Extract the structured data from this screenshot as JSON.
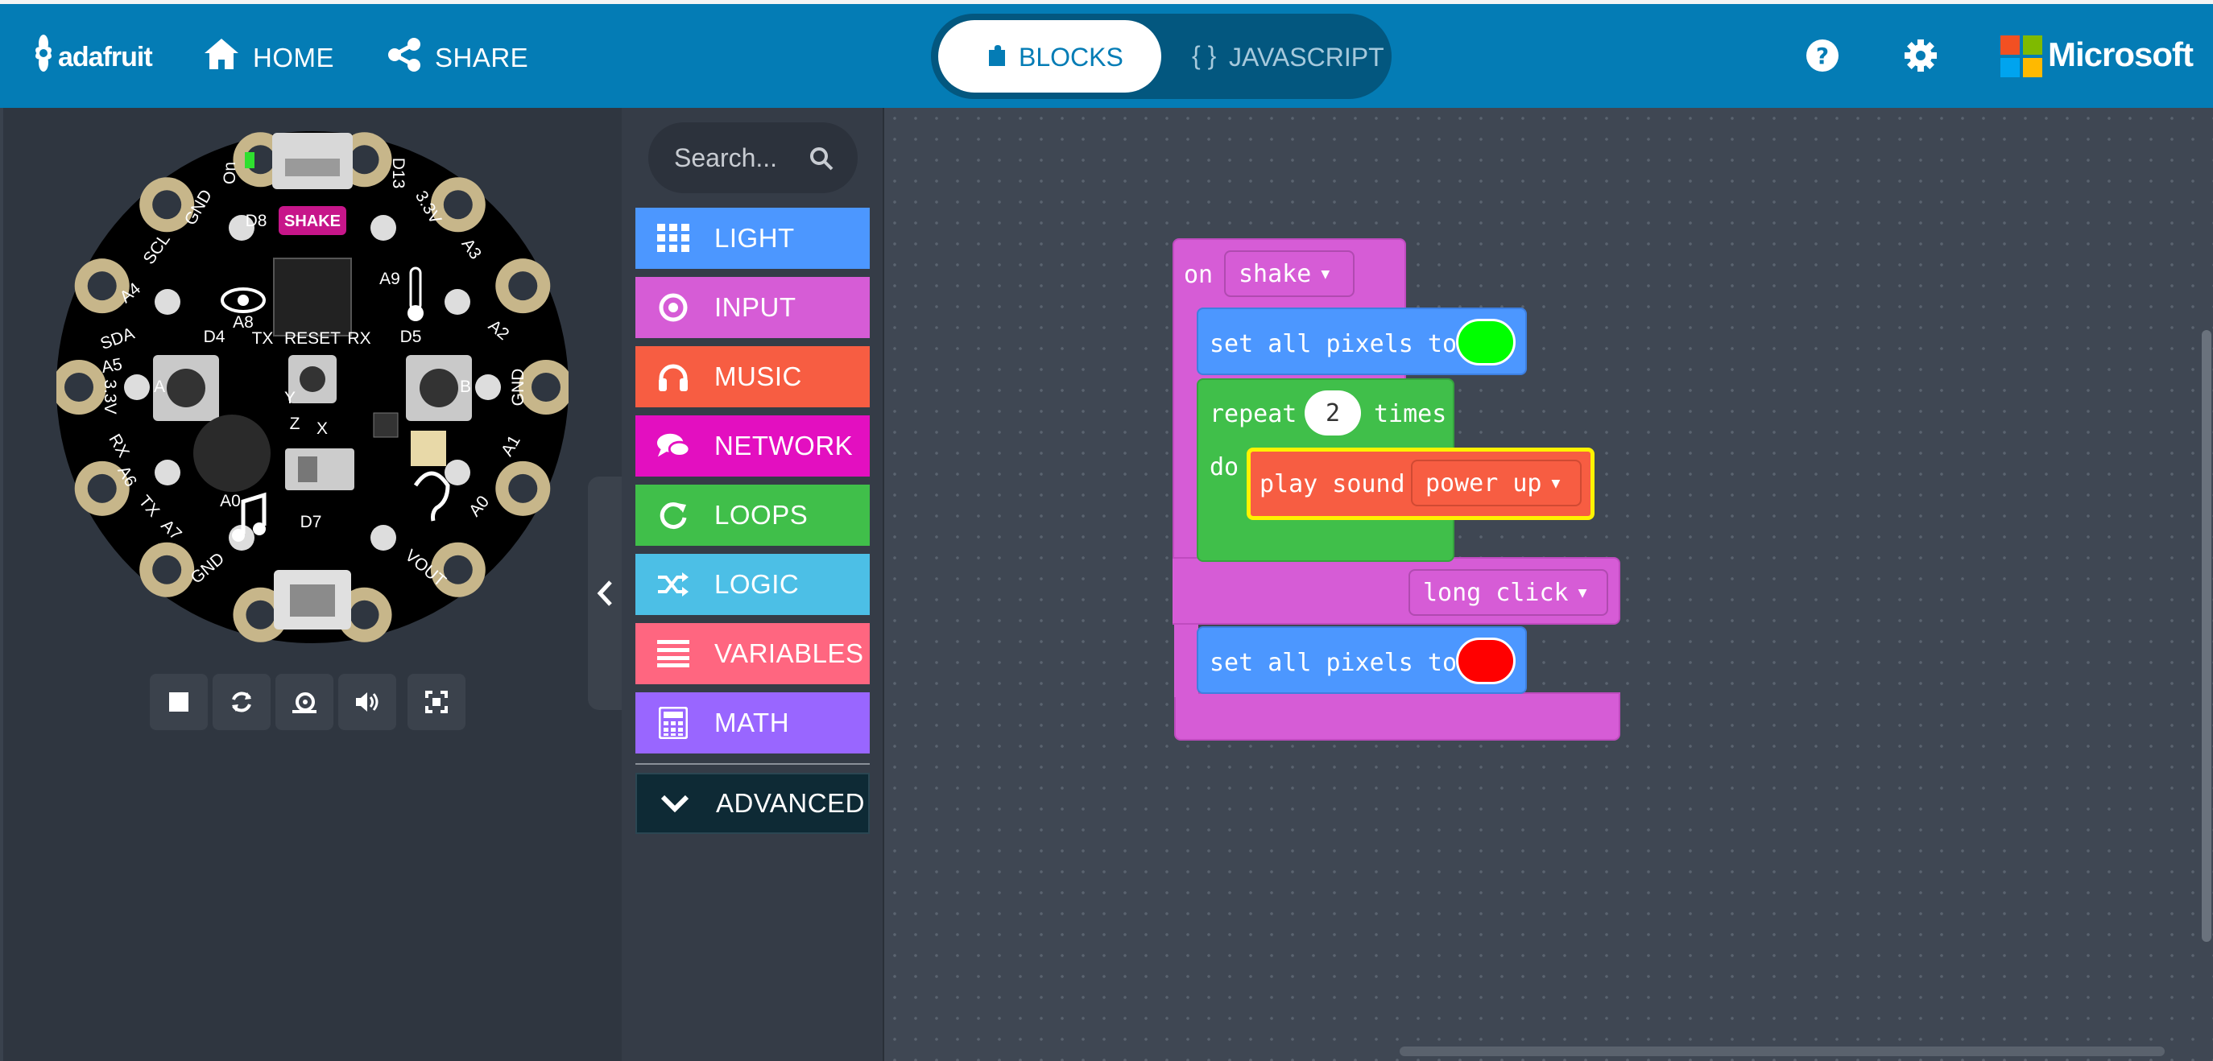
{
  "header": {
    "logo_text": "adafruit",
    "home_label": "HOME",
    "share_label": "SHARE",
    "blocks_tab_label": "BLOCKS",
    "javascript_tab_label": "JAVASCRIPT",
    "brand_label": "Microsoft"
  },
  "simulator": {
    "board_labels": {
      "on": "On",
      "d13": "D13",
      "gnd_tl": "GND",
      "d8": "D8",
      "shake_badge": "SHAKE",
      "v33_tr": "3.3V",
      "scl": "SCL",
      "a3": "A3",
      "a4": "A4",
      "a9": "A9",
      "a8": "A8",
      "sda": "SDA",
      "a2": "A2",
      "a5": "A5",
      "d4": "D4",
      "tx_top": "TX",
      "reset": "RESET",
      "rx_top": "RX",
      "d5": "D5",
      "v33_l": "3.3V",
      "gnd_r": "GND",
      "btn_a": "A",
      "btn_b": "B",
      "rx_l": "RX",
      "a6": "A6",
      "a1": "A1",
      "tx_l": "TX",
      "a7": "A7",
      "a0_mid": "A0",
      "a0_r": "A0",
      "d7": "D7",
      "gnd_bl": "GND",
      "vout": "VOUT",
      "z": "Z",
      "y": "Y",
      "x": "X"
    },
    "controls": [
      "stop-icon",
      "restart-icon",
      "slow-motion-icon",
      "sound-icon",
      "fullscreen-icon"
    ]
  },
  "toolbox": {
    "search_placeholder": "Search...",
    "categories": [
      {
        "label": "LIGHT",
        "color": "#4c97ff"
      },
      {
        "label": "INPUT",
        "color": "#d65cd6"
      },
      {
        "label": "MUSIC",
        "color": "#f75d42"
      },
      {
        "label": "NETWORK",
        "color": "#e30fc0"
      },
      {
        "label": "LOOPS",
        "color": "#40bf4a"
      },
      {
        "label": "LOGIC",
        "color": "#4cbfe6"
      },
      {
        "label": "VARIABLES",
        "color": "#ff6680"
      },
      {
        "label": "MATH",
        "color": "#9966ff"
      }
    ],
    "advanced_label": "ADVANCED"
  },
  "workspace": {
    "event_block": {
      "prefix": "on",
      "dropdown": "shake",
      "color": "#d65cd6"
    },
    "set_pixels_1": {
      "label": "set all pixels to",
      "color_value": "#00ff00"
    },
    "repeat_block": {
      "label_repeat": "repeat",
      "count": "2",
      "label_times": "times",
      "label_do": "do",
      "color": "#40bf4a"
    },
    "play_sound": {
      "label": "play sound",
      "dropdown": "power up",
      "color": "#f75d42"
    },
    "second_event": {
      "dropdown": "long click"
    },
    "set_pixels_2": {
      "label": "set all pixels to",
      "color_value": "#ff0000"
    }
  }
}
